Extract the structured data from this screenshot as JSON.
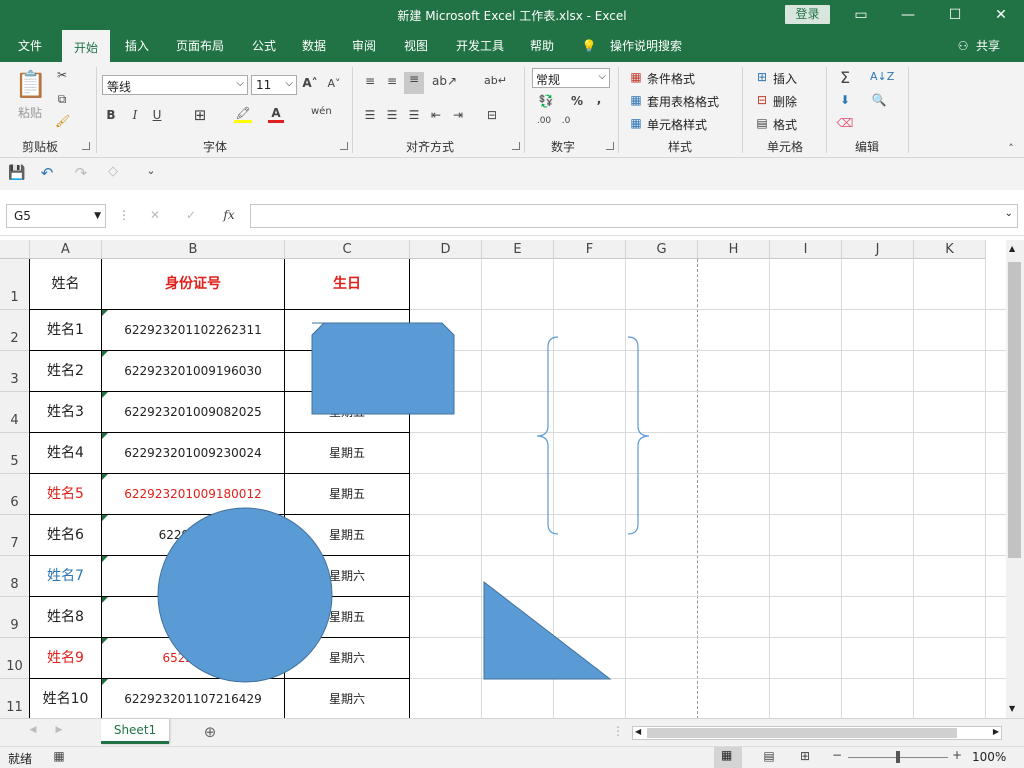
{
  "title": "新建 Microsoft Excel 工作表.xlsx  -  Excel",
  "login": "登录",
  "tabs": [
    "文件",
    "开始",
    "插入",
    "页面布局",
    "公式",
    "数据",
    "审阅",
    "视图",
    "开发工具",
    "帮助",
    "操作说明搜索"
  ],
  "share": "共享",
  "ribbon": {
    "paste": "粘贴",
    "clipboard": "剪贴板",
    "font_name": "等线",
    "font_size": "11",
    "font_group": "字体",
    "align_group": "对齐方式",
    "number_format": "常规",
    "number_group": "数字",
    "cond_format": "条件格式",
    "table_format": "套用表格格式",
    "cell_style": "单元格样式",
    "style_group": "样式",
    "insert": "插入",
    "delete": "删除",
    "format": "格式",
    "cells_group": "单元格",
    "edit_group": "编辑"
  },
  "name_box": "G5",
  "fx": "fx",
  "columns": [
    "A",
    "B",
    "C",
    "D",
    "E",
    "F",
    "G",
    "H",
    "I",
    "J",
    "K"
  ],
  "rows": [
    "1",
    "2",
    "3",
    "4",
    "5",
    "6",
    "7",
    "8",
    "9",
    "10",
    "11"
  ],
  "headers": {
    "name": "姓名",
    "id": "身份证号",
    "birthday": "生日"
  },
  "data": [
    {
      "name": "姓名1",
      "id": "622923201102262311",
      "day": ""
    },
    {
      "name": "姓名2",
      "id": "622923201009196030",
      "day": ""
    },
    {
      "name": "姓名3",
      "id": "622923201009082025",
      "day": "星期五"
    },
    {
      "name": "姓名4",
      "id": "622923201009230024",
      "day": "星期五"
    },
    {
      "name": "姓名5",
      "id": "622923201009180012",
      "day": "星期五"
    },
    {
      "name": "姓名6",
      "id": "622923201",
      "day": "星期五"
    },
    {
      "name": "姓名7",
      "id": "62292",
      "day": "星期六"
    },
    {
      "name": "姓名8",
      "id": "62292",
      "day": "星期五"
    },
    {
      "name": "姓名9",
      "id": "65220120",
      "day": "星期六"
    },
    {
      "name": "姓名10",
      "id": "622923201107216429",
      "day": "星期六"
    }
  ],
  "sheet_tab": "Sheet1",
  "status": "就绪",
  "zoom": "100%",
  "colors": {
    "green": "#217346",
    "red": "#e0201b",
    "blue": "#2e75b6",
    "shape": "#5b9bd5",
    "shape_border": "#41719c"
  }
}
